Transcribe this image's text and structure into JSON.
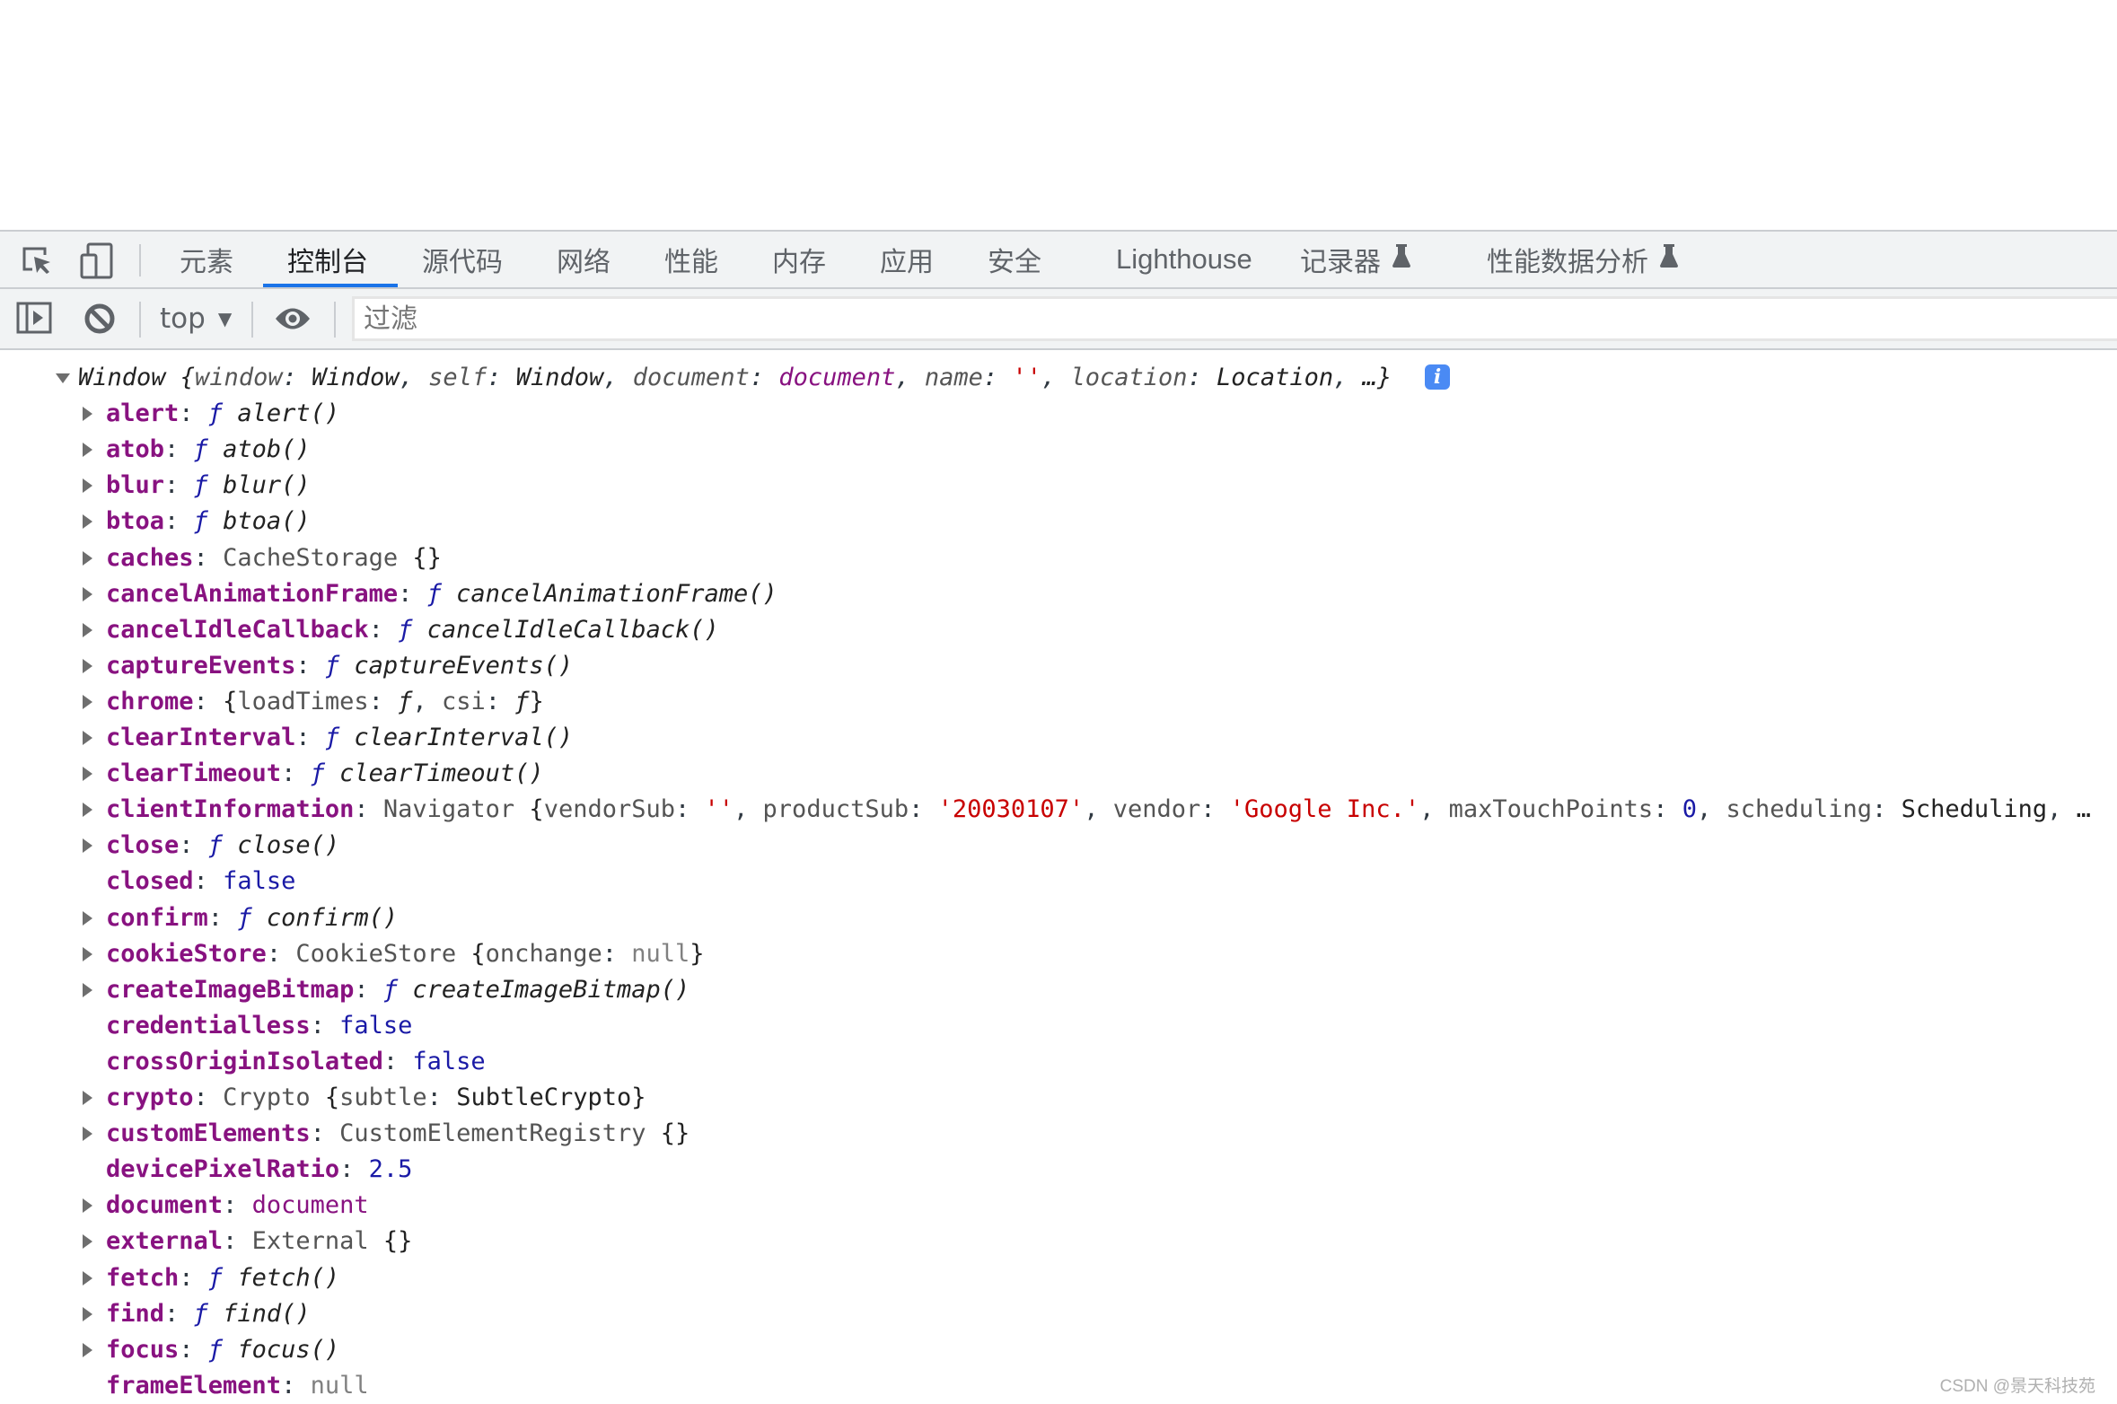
{
  "devtools": {
    "tabs": [
      {
        "label": "元素",
        "active": false
      },
      {
        "label": "控制台",
        "active": true
      },
      {
        "label": "源代码",
        "active": false
      },
      {
        "label": "网络",
        "active": false
      },
      {
        "label": "性能",
        "active": false
      },
      {
        "label": "内存",
        "active": false
      },
      {
        "label": "应用",
        "active": false
      },
      {
        "label": "安全",
        "active": false
      },
      {
        "label": "Lighthouse",
        "active": false
      },
      {
        "label": "记录器",
        "active": false,
        "experimental": true
      },
      {
        "label": "性能数据分析",
        "active": false,
        "experimental": true
      }
    ],
    "toolbar_icons": {
      "inspect": "inspect-element-icon",
      "device": "device-toolbar-icon",
      "sidebar": "show-sidebar-icon",
      "clear": "clear-console-icon",
      "eye": "live-expression-icon",
      "flask": "experimental-flask-icon",
      "info": "info-icon"
    },
    "accent_color": "#1a73e8"
  },
  "console_toolbar": {
    "context": "top",
    "filter_placeholder": "过滤"
  },
  "console": {
    "header": {
      "object_name": "Window",
      "preview": [
        {
          "key": "window",
          "value": "Window",
          "type": "obj"
        },
        {
          "key": "self",
          "value": "Window",
          "type": "obj"
        },
        {
          "key": "document",
          "value": "document",
          "type": "doc"
        },
        {
          "key": "name",
          "value": "''",
          "type": "str"
        },
        {
          "key": "location",
          "value": "Location",
          "type": "obj"
        }
      ],
      "ellipsis": "…}"
    },
    "properties": [
      {
        "key": "alert",
        "expandable": true,
        "kind": "function",
        "value": "alert()"
      },
      {
        "key": "atob",
        "expandable": true,
        "kind": "function",
        "value": "atob()"
      },
      {
        "key": "blur",
        "expandable": true,
        "kind": "function",
        "value": "blur()"
      },
      {
        "key": "btoa",
        "expandable": true,
        "kind": "function",
        "value": "btoa()"
      },
      {
        "key": "caches",
        "expandable": true,
        "kind": "object",
        "class": "CacheStorage",
        "value": "{}"
      },
      {
        "key": "cancelAnimationFrame",
        "expandable": true,
        "kind": "function",
        "value": "cancelAnimationFrame()"
      },
      {
        "key": "cancelIdleCallback",
        "expandable": true,
        "kind": "function",
        "value": "cancelIdleCallback()"
      },
      {
        "key": "captureEvents",
        "expandable": true,
        "kind": "function",
        "value": "captureEvents()"
      },
      {
        "key": "chrome",
        "expandable": true,
        "kind": "chrome",
        "value": "{loadTimes: ƒ, csi: ƒ}"
      },
      {
        "key": "clearInterval",
        "expandable": true,
        "kind": "function",
        "value": "clearInterval()"
      },
      {
        "key": "clearTimeout",
        "expandable": true,
        "kind": "function",
        "value": "clearTimeout()"
      },
      {
        "key": "clientInformation",
        "expandable": true,
        "kind": "navigator",
        "class": "Navigator",
        "preview": {
          "vendorSub": "''",
          "productSub": "'20030107'",
          "vendor": "'Google Inc.'",
          "maxTouchPoints": "0",
          "scheduling": "Scheduling"
        }
      },
      {
        "key": "close",
        "expandable": true,
        "kind": "function",
        "value": "close()"
      },
      {
        "key": "closed",
        "expandable": false,
        "kind": "boolean",
        "value": "false"
      },
      {
        "key": "confirm",
        "expandable": true,
        "kind": "function",
        "value": "confirm()"
      },
      {
        "key": "cookieStore",
        "expandable": true,
        "kind": "cookiestore",
        "class": "CookieStore",
        "value": "{onchange: null}"
      },
      {
        "key": "createImageBitmap",
        "expandable": true,
        "kind": "function",
        "value": "createImageBitmap()"
      },
      {
        "key": "credentialless",
        "expandable": false,
        "kind": "boolean",
        "value": "false"
      },
      {
        "key": "crossOriginIsolated",
        "expandable": false,
        "kind": "boolean",
        "value": "false"
      },
      {
        "key": "crypto",
        "expandable": true,
        "kind": "crypto",
        "class": "Crypto",
        "value": "{subtle: SubtleCrypto}"
      },
      {
        "key": "customElements",
        "expandable": true,
        "kind": "object",
        "class": "CustomElementRegistry",
        "value": "{}"
      },
      {
        "key": "devicePixelRatio",
        "expandable": false,
        "kind": "number",
        "value": "2.5"
      },
      {
        "key": "document",
        "expandable": true,
        "kind": "document",
        "value": "document"
      },
      {
        "key": "external",
        "expandable": true,
        "kind": "object",
        "class": "External",
        "value": "{}"
      },
      {
        "key": "fetch",
        "expandable": true,
        "kind": "function",
        "value": "fetch()"
      },
      {
        "key": "find",
        "expandable": true,
        "kind": "function",
        "value": "find()"
      },
      {
        "key": "focus",
        "expandable": true,
        "kind": "function",
        "value": "focus()"
      },
      {
        "key": "frameElement",
        "expandable": false,
        "kind": "null",
        "value": "null"
      }
    ]
  },
  "watermark": "CSDN @景天科技苑"
}
